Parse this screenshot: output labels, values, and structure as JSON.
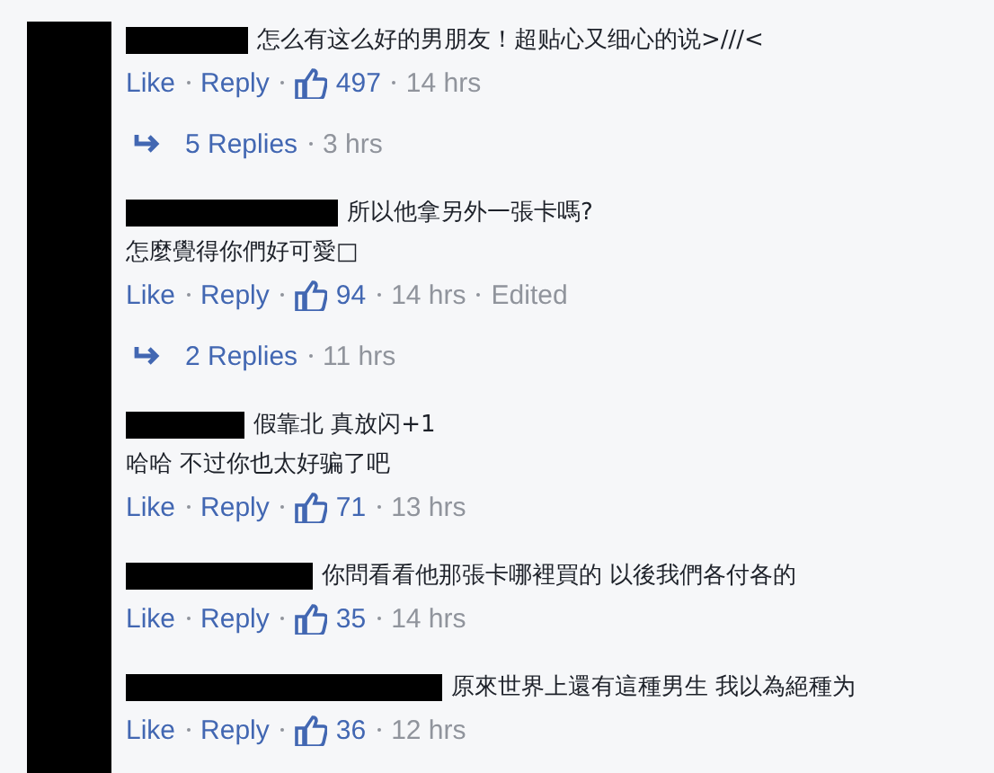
{
  "comments": [
    {
      "lines": [
        "怎么有这么好的男朋友！超贴心又细心的说>///<"
      ],
      "like": "Like",
      "reply": "Reply",
      "likes": "497",
      "time": "14 hrs",
      "replies": {
        "label": "5 Replies",
        "time": "3 hrs"
      }
    },
    {
      "lines": [
        "所以他拿另外一張卡嗎?",
        "怎麼覺得你們好可愛□"
      ],
      "like": "Like",
      "reply": "Reply",
      "likes": "94",
      "time": "14 hrs",
      "edited": "Edited",
      "replies": {
        "label": "2 Replies",
        "time": "11 hrs"
      }
    },
    {
      "lines": [
        "假靠北 真放闪+1",
        "哈哈 不过你也太好骗了吧"
      ],
      "like": "Like",
      "reply": "Reply",
      "likes": "71",
      "time": "13 hrs"
    },
    {
      "lines": [
        "你問看看他那張卡哪裡買的 以後我們各付各的"
      ],
      "like": "Like",
      "reply": "Reply",
      "likes": "35",
      "time": "14 hrs"
    },
    {
      "lines": [
        "原來世界上還有這種男生 我以為絕種为"
      ],
      "like": "Like",
      "reply": "Reply",
      "likes": "36",
      "time": "12 hrs"
    }
  ]
}
